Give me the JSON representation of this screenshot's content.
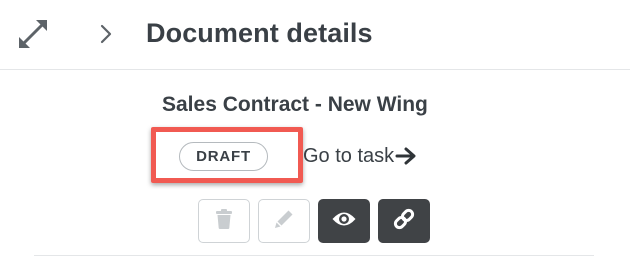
{
  "header": {
    "title": "Document details",
    "expand_icon": "expand-arrows-icon",
    "chevron_icon": "chevron-right-icon"
  },
  "document": {
    "title": "Sales Contract - New Wing",
    "status": "DRAFT",
    "goto_task_label": "Go to task"
  },
  "actions": [
    {
      "name": "delete",
      "icon": "trash-icon",
      "style": "outline"
    },
    {
      "name": "edit",
      "icon": "pencil-icon",
      "style": "outline"
    },
    {
      "name": "preview",
      "icon": "eye-icon",
      "style": "dark"
    },
    {
      "name": "link",
      "icon": "link-icon",
      "style": "dark"
    }
  ],
  "colors": {
    "text": "#3a4046",
    "highlight": "#f15a52",
    "dark_button": "#404346",
    "disabled_icon": "#c9cdd0"
  }
}
